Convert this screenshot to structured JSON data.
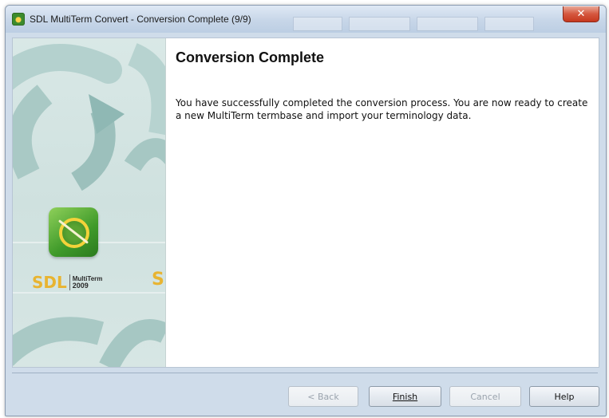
{
  "window": {
    "title": "SDL MultiTerm Convert - Conversion Complete (9/9)"
  },
  "banner": {
    "brand": "SDL",
    "product": "MultiTerm",
    "year": "2009",
    "ghost_letter": "S"
  },
  "page": {
    "heading": "Conversion Complete",
    "message": "You have successfully completed the conversion process. You are now ready to create a new MultiTerm termbase and import your terminology data."
  },
  "buttons": {
    "back": {
      "label": "< Back",
      "enabled": false
    },
    "finish": {
      "label": "Finish",
      "enabled": true
    },
    "cancel": {
      "label": "Cancel",
      "enabled": false
    },
    "help": {
      "label": "Help",
      "enabled": true
    }
  },
  "icons": {
    "app": "app-icon",
    "close": "close-icon",
    "logo": "multiterm-logo-icon"
  },
  "colors": {
    "title_bar": "#c7d6e8",
    "close_button": "#d5573f",
    "brand_gold": "#e8b431",
    "logo_green": "#3f9a2a"
  }
}
